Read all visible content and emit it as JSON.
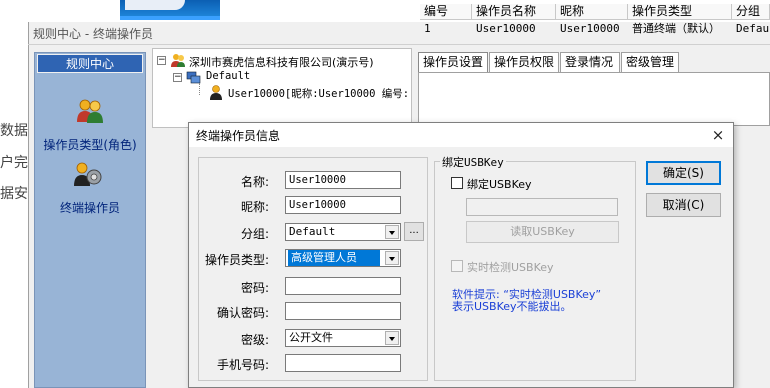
{
  "window": {
    "title": "规则中心 - 终端操作员"
  },
  "bg_texts": [
    "数据",
    "户完",
    "据安"
  ],
  "nav": {
    "header": "规则中心",
    "items": [
      {
        "label": "操作员类型(角色)",
        "icon": "users-icon"
      },
      {
        "label": "终端操作员",
        "icon": "user-gear-icon"
      }
    ]
  },
  "tree": {
    "root": "深圳市赛虎信息科技有限公司(演示号)",
    "group": "Default",
    "user": "User10000[昵称:User10000 编号:"
  },
  "tabs": [
    "操作员设置",
    "操作员权限",
    "登录情况",
    "密级管理"
  ],
  "grid": {
    "columns": [
      "编号",
      "操作员名称",
      "昵称",
      "操作员类型",
      "分组"
    ],
    "rows": [
      [
        "1",
        "User10000",
        "User10000",
        "普通终端（默认）",
        "Default"
      ]
    ]
  },
  "dialog": {
    "title": "终端操作员信息",
    "close": "×",
    "fields": {
      "name_label": "名称:",
      "name_value": "User10000",
      "nick_label": "昵称:",
      "nick_value": "User10000",
      "group_label": "分组:",
      "group_value": "Default",
      "group_browse": "...",
      "type_label": "操作员类型:",
      "type_value": "高级管理人员",
      "pwd_label": "密码:",
      "pwd_value": "",
      "confirm_label": "确认密码:",
      "confirm_value": "",
      "level_label": "密级:",
      "level_value": "公开文件",
      "phone_label": "手机号码:",
      "phone_value": ""
    },
    "usb": {
      "group_title": "绑定USBKey",
      "bind_label": "绑定USBKey",
      "key_value": "",
      "read_button": "读取USBKey",
      "realtime_label": "实时检测USBKey",
      "hint_line1": "软件提示: “实时检测USBKey”",
      "hint_line2": "表示USBKey不能拔出。"
    },
    "ok_button": "确定(S)",
    "cancel_button": "取消(C)"
  },
  "colors": {
    "nav_bg": "#98b4d6",
    "nav_header": "#2f64b3",
    "nav_text": "#00237a",
    "hint_text": "#1a3fd6",
    "selection": "#0078d7"
  }
}
